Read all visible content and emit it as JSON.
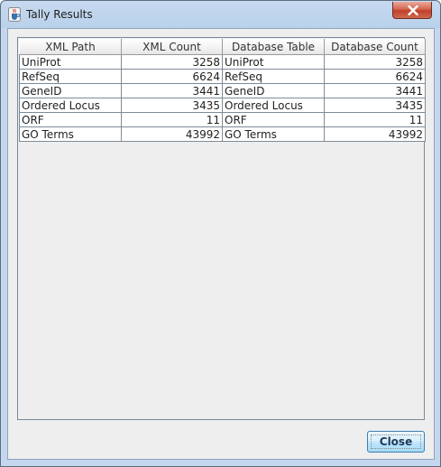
{
  "window": {
    "title": "Tally Results",
    "app_icon": "java-cup-icon",
    "close_glyph": "close-icon"
  },
  "table": {
    "headers": [
      "XML Path",
      "XML Count",
      "Database Table",
      "Database Count"
    ],
    "rows": [
      [
        "UniProt",
        "3258",
        "UniProt",
        "3258"
      ],
      [
        "RefSeq",
        "6624",
        "RefSeq",
        "6624"
      ],
      [
        "GeneID",
        "3441",
        "GeneID",
        "3441"
      ],
      [
        "Ordered Locus",
        "3435",
        "Ordered Locus",
        "3435"
      ],
      [
        "ORF",
        "11",
        "ORF",
        "11"
      ],
      [
        "GO Terms",
        "43992",
        "GO Terms",
        "43992"
      ]
    ]
  },
  "buttons": {
    "close_label": "Close"
  },
  "colors": {
    "title_bar": "#b9d1ea",
    "close_red": "#c0402a",
    "button_border": "#3c7fb1"
  }
}
